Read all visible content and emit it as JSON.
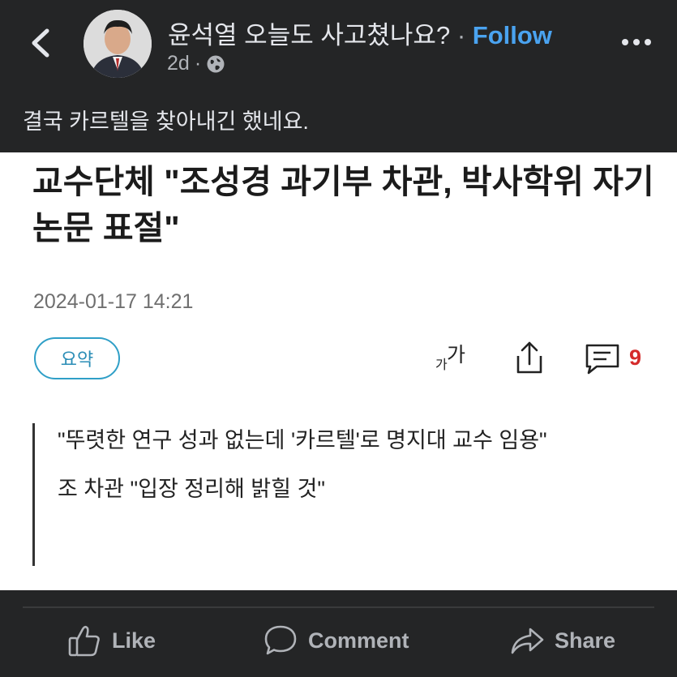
{
  "post": {
    "group_name": "윤석열 오늘도 사고쳤나요?",
    "separator": "·",
    "follow_label": "Follow",
    "time": "2d",
    "meta_dot": "·",
    "caption": "결국 카르텔을 찾아내긴 했네요."
  },
  "article": {
    "headline": "교수단체 \"조성경 과기부 차관, 박사학위 자기논문 표절\"",
    "date": "2024-01-17 14:21",
    "summary_label": "요약",
    "font_icon_big": "가",
    "font_icon_small": "가",
    "comment_count": "9",
    "quote_line1": "\"뚜렷한 연구 성과 없는데 '카르텔'로 명지대 교수 임용\"",
    "quote_line2": "조 차관 \"입장 정리해 밝힐 것\""
  },
  "actions": {
    "like_label": "Like",
    "comment_label": "Comment",
    "share_label": "Share"
  },
  "colors": {
    "background": "#242526",
    "follow": "#4aa3f0",
    "summary_border": "#2f9fc7",
    "comment_count": "#d52b2b"
  },
  "icons": [
    "back-arrow-icon",
    "globe-icon",
    "more-dots-icon",
    "font-size-icon",
    "share-upload-icon",
    "comment-box-icon",
    "like-thumb-icon",
    "comment-bubble-icon",
    "share-arrow-icon"
  ]
}
